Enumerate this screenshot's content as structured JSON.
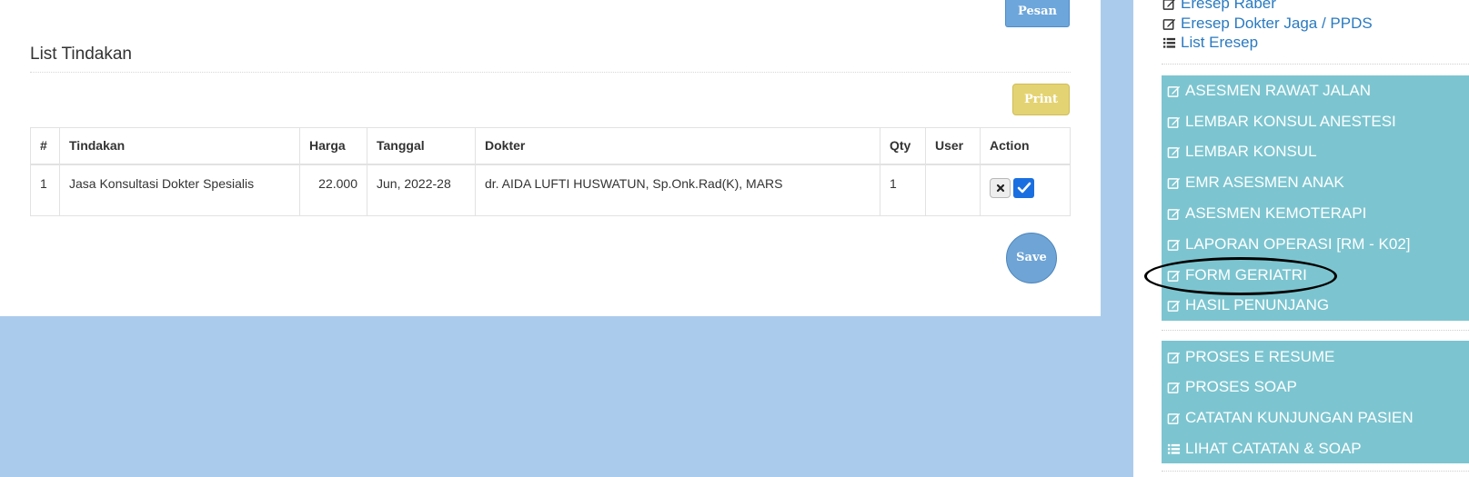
{
  "main": {
    "pesan_label": "Pesan",
    "section_title": "List Tindakan",
    "print_label": "Print",
    "save_label": "Save",
    "table": {
      "headers": [
        "#",
        "Tindakan",
        "Harga",
        "Tanggal",
        "Dokter",
        "Qty",
        "User",
        "Action"
      ],
      "rows": [
        {
          "no": "1",
          "tindakan": "Jasa Konsultasi Dokter Spesialis",
          "harga": "22.000",
          "tanggal": "Jun, 2022-28",
          "dokter": "dr. AIDA LUFTI HUSWATUN, Sp.Onk.Rad(K), MARS",
          "qty": "1",
          "user": ""
        }
      ]
    }
  },
  "sidebar": {
    "links": [
      {
        "label": "Eresep Raber",
        "icon": "edit-icon"
      },
      {
        "label": "Eresep Dokter Jaga / PPDS",
        "icon": "edit-icon"
      },
      {
        "label": "List Eresep",
        "icon": "list-icon"
      }
    ],
    "menu_group_1": [
      {
        "label": "ASESMEN RAWAT JALAN",
        "icon": "edit-icon"
      },
      {
        "label": "LEMBAR KONSUL ANESTESI",
        "icon": "edit-icon"
      },
      {
        "label": "LEMBAR KONSUL",
        "icon": "edit-icon"
      },
      {
        "label": "EMR ASESMEN ANAK",
        "icon": "edit-icon"
      },
      {
        "label": "ASESMEN KEMOTERAPI",
        "icon": "edit-icon"
      },
      {
        "label": "LAPORAN OPERASI [RM - K02]",
        "icon": "edit-icon"
      },
      {
        "label": "FORM GERIATRI",
        "icon": "edit-icon"
      },
      {
        "label": "HASIL PENUNJANG",
        "icon": "edit-icon"
      }
    ],
    "menu_group_2": [
      {
        "label": "PROSES E RESUME",
        "icon": "edit-icon"
      },
      {
        "label": "PROSES SOAP",
        "icon": "edit-icon"
      },
      {
        "label": "CATATAN KUNJUNGAN PASIEN",
        "icon": "edit-icon"
      },
      {
        "label": "LIHAT CATATAN & SOAP",
        "icon": "list-icon"
      }
    ]
  },
  "colors": {
    "page_bg": "#abcbec",
    "menu_bg": "#7cc5d0",
    "link": "#2a7ac0",
    "primary_button": "#6da6db",
    "print_button": "#e4d372",
    "checkbox": "#1a6fe0"
  }
}
